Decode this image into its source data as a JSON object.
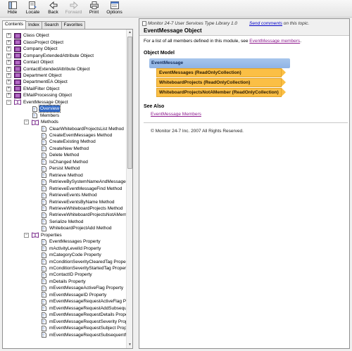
{
  "toolbar": {
    "buttons": [
      {
        "label": "Hide",
        "icon": "hide-pane-icon",
        "enabled": true
      },
      {
        "label": "Locate",
        "icon": "locate-icon",
        "enabled": true
      },
      {
        "label": "Back",
        "icon": "back-arrow-icon",
        "enabled": true
      },
      {
        "label": "Forward",
        "icon": "forward-arrow-icon",
        "enabled": false
      },
      {
        "label": "Print",
        "icon": "printer-icon",
        "enabled": true
      },
      {
        "label": "Options",
        "icon": "options-icon",
        "enabled": true
      }
    ]
  },
  "nav_tabs": [
    "Contents",
    "Index",
    "Search",
    "Favorites"
  ],
  "tree": {
    "top_items": [
      "Class Object",
      "ClassProject Object",
      "Company Object",
      "CompanyExtendedAttribute Object",
      "Contact Object",
      "ContactExtendedAttribute Object",
      "Department Object",
      "DepartmentEA Object",
      "EMailFilter Object",
      "EMailProcessing Object"
    ],
    "open_item": "EventMessage Object",
    "open_children": [
      "Overview",
      "Members"
    ],
    "methods_label": "Methods",
    "methods": [
      "ClearWhiteboardProjectsList Method",
      "CreateEventMessages Method",
      "CreateExisting Method",
      "CreateNew Method",
      "Delete Method",
      "IsChanged Method",
      "Persist Method",
      "Retrieve Method",
      "RetrieveBySystemNameAndMessageID M",
      "RetrieveEventMessageFind Method",
      "RetrieveEvents Method",
      "RetrieveEventsByName Method",
      "RetrieveWhiteboardProjects Method",
      "RetrieveWhiteboardProjectsNotAMembe",
      "Serialize Method",
      "WhiteboardProjectAdd Method"
    ],
    "properties_label": "Properties",
    "properties": [
      "EventMessages Property",
      "mActivityLevelId Property",
      "mCategoryCode Property",
      "mConditionSeverityClearedTag Property",
      "mConditionSeverityStartedTag Property",
      "mContactID Property",
      "mDetails Property",
      "mEventMessageActiveFlag Property",
      "mEventMessageID Property",
      "mEventMessageRequestActiveFlag Property",
      "mEventMessageRequestAddSubsequen",
      "mEventMessageRequestDetails Property",
      "mEventMessageRequestSeverity Property",
      "mEventMessageRequestSubject Property",
      "mEventMessageRequestSubsequentMe"
    ]
  },
  "content": {
    "library": "Monitor 24-7 User Services Type Library 1.0",
    "feedback_link": "Send comments",
    "feedback_suffix": " on this topic.",
    "title": "EventMessage Object",
    "intro_prefix": "For a list of all members defined in this module, see ",
    "intro_link": "EventMessage members",
    "intro_suffix": ".",
    "object_model_heading": "Object Model",
    "object_model_root": "EventMessage",
    "object_model_items": [
      "EventMessages (ReadOnlyCollection)",
      "WhiteboardProjects (ReadOnlyCollection)",
      "WhiteboardProjectsNotAMember (ReadOnlyCollection)"
    ],
    "see_also_heading": "See Also",
    "see_also_link": "EventMessage Members",
    "copyright": "© Monitor 24-7 Inc. 2007 All Rights Reserved."
  },
  "colors": {
    "selection": "#3169c6",
    "link": "#0000c8",
    "visited_link": "#8e1d8f",
    "om_root": "#a7c6ec",
    "om_item": "#fbbf45",
    "book": "#7a2c8c"
  }
}
